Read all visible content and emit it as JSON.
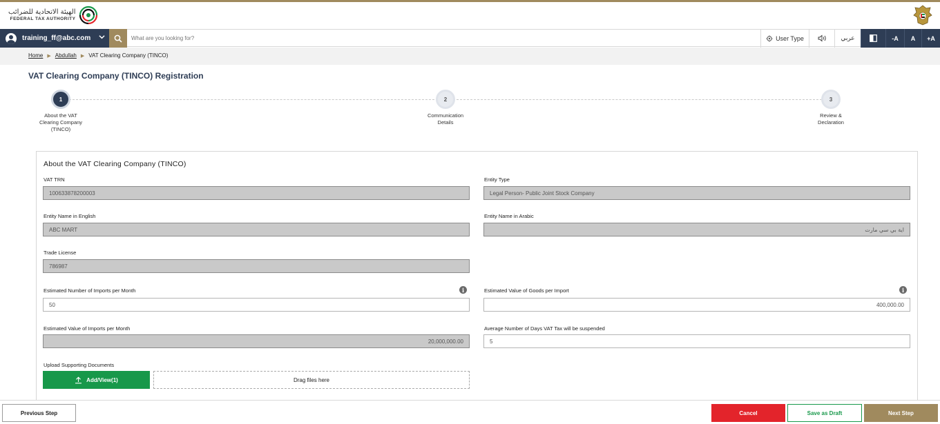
{
  "header": {
    "logo_ar": "الهيئة الاتحادية للضرائب",
    "logo_en": "FEDERAL TAX AUTHORITY"
  },
  "navbar": {
    "user_email": "training_ff@abc.com",
    "search_placeholder": "What are you looking for?",
    "user_type_label": "User Type",
    "arabic_label": "عربي",
    "font_decrease": "-A",
    "font_normal": "A",
    "font_increase": "+A"
  },
  "breadcrumb": {
    "home": "Home",
    "parent": "Abdullah",
    "current": "VAT Clearing Company (TINCO)"
  },
  "page": {
    "title": "VAT Clearing Company (TINCO) Registration"
  },
  "steps": [
    {
      "number": "1",
      "label": "About the VAT\nClearing Company\n(TINCO)",
      "active": true
    },
    {
      "number": "2",
      "label": "Communication\nDetails",
      "active": false
    },
    {
      "number": "3",
      "label": "Review &\nDeclaration",
      "active": false
    }
  ],
  "form": {
    "section_title": "About the VAT Clearing Company (TINCO)",
    "vat_trn_label": "VAT TRN",
    "vat_trn_value": "100633878200003",
    "entity_type_label": "Entity Type",
    "entity_type_value": "Legal Person- Public Joint Stock Company",
    "entity_name_en_label": "Entity Name in English",
    "entity_name_en_value": "ABC MART",
    "entity_name_ar_label": "Entity Name in Arabic",
    "entity_name_ar_value": "اية بي سي مارت",
    "trade_license_label": "Trade License",
    "trade_license_value": "786987",
    "imports_per_month_label": "Estimated Number of Imports per Month",
    "imports_per_month_value": "50",
    "goods_value_label": "Estimated Value of Goods per Import",
    "goods_value_value": "400,000.00",
    "imports_value_label": "Estimated Value of Imports per Month",
    "imports_value_value": "20,000,000.00",
    "days_suspended_label": "Average Number of Days VAT Tax will be suspended",
    "days_suspended_value": "5",
    "upload_label": "Upload Supporting Documents",
    "add_view_label": "Add/View(1)",
    "drag_label": "Drag files here"
  },
  "footer": {
    "previous": "Previous Step",
    "cancel": "Cancel",
    "save_draft": "Save as Draft",
    "next": "Next Step"
  },
  "colors": {
    "navy": "#2e3d55",
    "gold": "#a08a5e",
    "green": "#17984a",
    "red": "#e3242b"
  },
  "icons": {
    "search": "search-icon",
    "user": "user-avatar-icon",
    "gear": "gear-icon",
    "speaker": "speaker-icon",
    "contrast": "contrast-icon",
    "info": "info-icon",
    "upload": "upload-icon"
  }
}
